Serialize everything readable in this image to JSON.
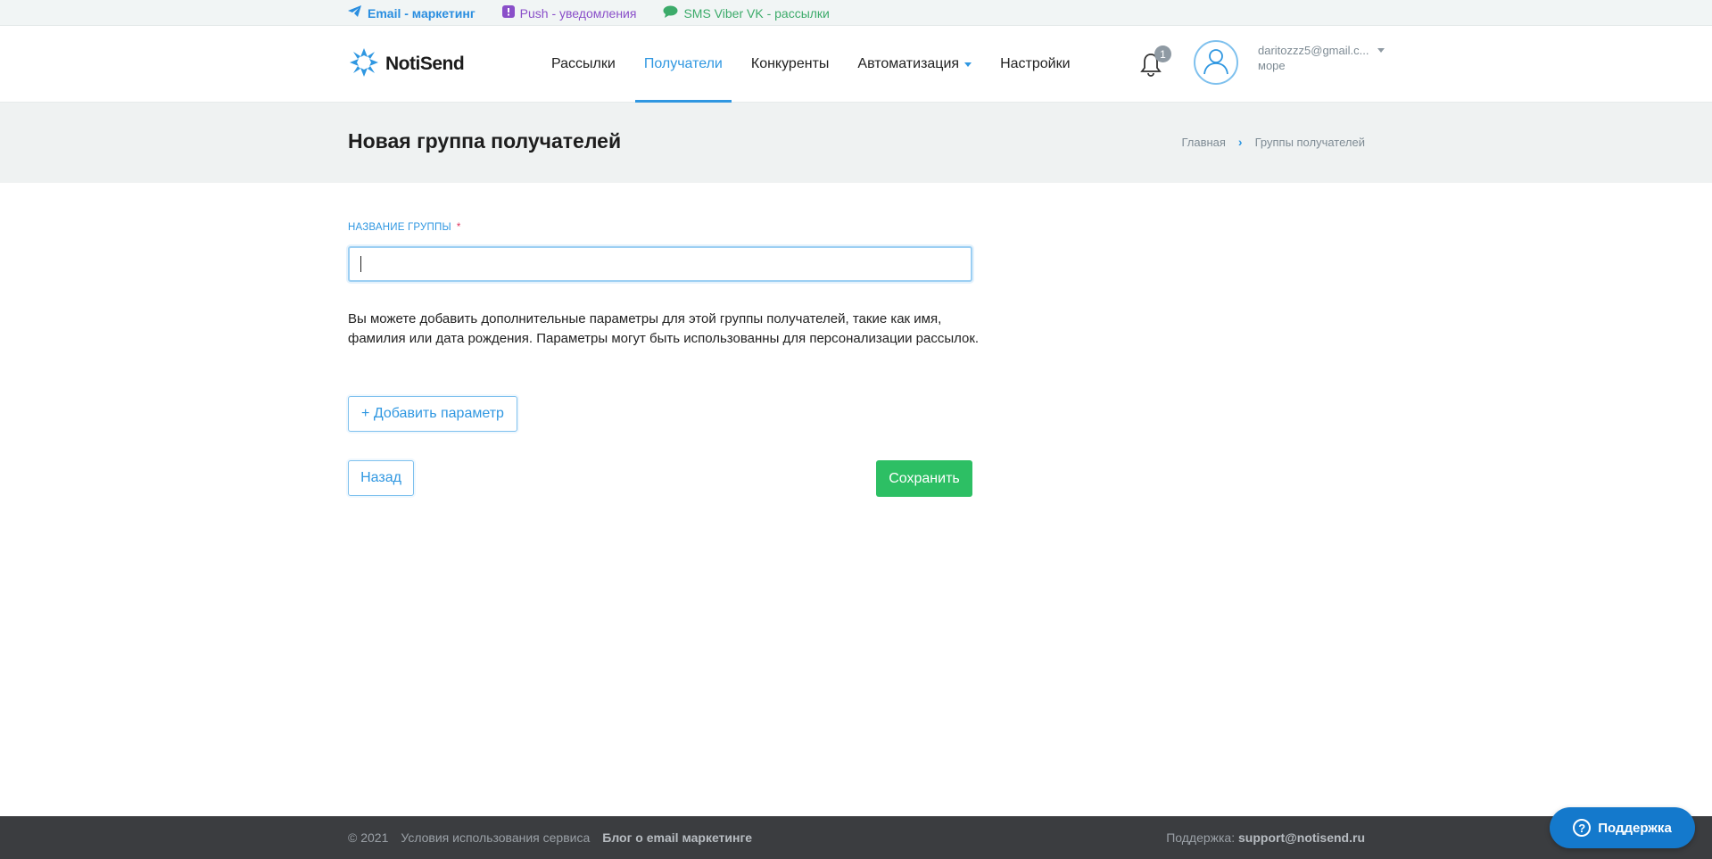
{
  "topstrip": {
    "email_label": "Email - маркетинг",
    "push_label": "Push - уведомления",
    "sms_label": "SMS Viber VK - рассылки"
  },
  "header": {
    "logo_text": "NotiSend",
    "nav": [
      {
        "label": "Рассылки"
      },
      {
        "label": "Получатели",
        "active": true
      },
      {
        "label": "Конкуренты"
      },
      {
        "label": "Автоматизация"
      },
      {
        "label": "Настройки"
      }
    ],
    "notification_count": "1",
    "user_email": "daritozzz5@gmail.c...",
    "user_sub": "море"
  },
  "titleband": {
    "title": "Новая группа получателей",
    "breadcrumb": [
      "Главная",
      "Группы получателей"
    ]
  },
  "form": {
    "group_name_label": "НАЗВАНИЕ ГРУППЫ",
    "required_mark": "*",
    "group_name_value": "",
    "info_text": "Вы можете добавить дополнительные параметры для этой группы получателей, такие как имя, фамилия или дата рождения. Параметры могут быть использованны для персонализации рассылок.",
    "add_param_label": "+ Добавить параметр",
    "back_label": "Назад",
    "save_label": "Сохранить"
  },
  "footer": {
    "copyright": "© 2021",
    "terms": "Условия использования сервиса",
    "blog": "Блог о email маркетинге",
    "support_prefix": "Поддержка: ",
    "support_email": "support@notisend.ru"
  },
  "support_widget": {
    "label": "Поддержка"
  },
  "colors": {
    "accent": "#2f97e1",
    "save": "#2dbf64",
    "footer_bg": "#3b3d40",
    "support_bg": "#1479cc"
  }
}
